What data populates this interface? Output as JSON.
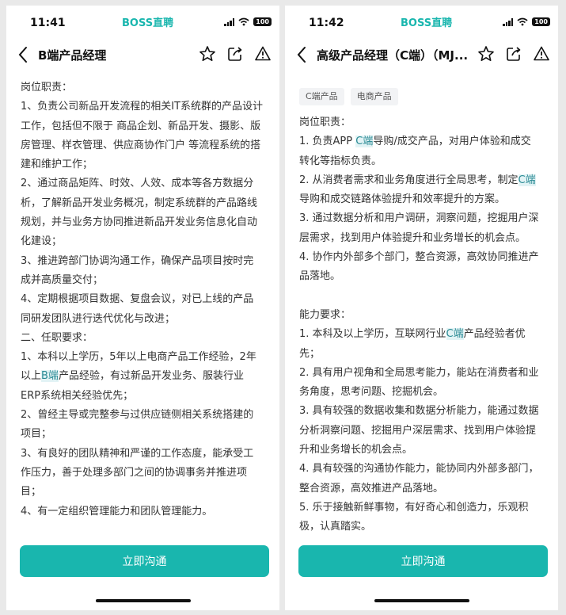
{
  "screens": [
    {
      "status": {
        "time": "11:41",
        "brand": "BOSS直聘",
        "battery": "100"
      },
      "nav": {
        "title": "B端产品经理"
      },
      "tags": [],
      "lines": [
        "岗位职责：",
        "1、负责公司新品开发流程的相关IT系统群的产品设计",
        "工作，包括但不限于 商品企划、新品开发、摄影、版",
        "房管理、样衣管理、供应商协作门户 等流程系统的搭",
        "建和维护工作；",
        "2、通过商品矩阵、时效、人效、成本等各方数据分",
        "析，了解新品开发业务概况，制定系统群的产品路线",
        "规划，并与业务方协同推进新品开发业务信息化自动",
        "化建设；",
        "3、推进跨部门协调沟通工作，确保产品项目按时完",
        "成并高质量交付；",
        "4、定期根据项目数据、复盘会议，对已上线的产品",
        "同研发团队进行迭代优化与改进；",
        "二、任职要求：",
        "1、本科以上学历，5年以上电商产品工作经验，2年",
        "以上B端产品经验，有过新品开发业务、服装行业",
        "ERP系统相关经验优先；",
        "2、曾经主导或完整参与过供应链侧相关系统搭建的",
        "项目；",
        "3、有良好的团队精神和严谨的工作态度，能承受工",
        "作压力，善于处理多部门之间的协调事务并推进项",
        "目；",
        "4、有一定组织管理能力和团队管理能力。"
      ],
      "cta": "立即沟通"
    },
    {
      "status": {
        "time": "11:42",
        "brand": "BOSS直聘",
        "battery": "100"
      },
      "nav": {
        "title": "高级产品经理（C端）（MJ..."
      },
      "tags": [
        "C端产品",
        "电商产品"
      ],
      "lines": [
        "岗位职责：",
        "1. 负责APP C端导购/成交产品，对用户体验和成交",
        "转化等指标负责。",
        "2. 从消费者需求和业务角度进行全局思考，制定C端",
        "导购和成交链路体验提升和效率提升的方案。",
        "3. 通过数据分析和用户调研，洞察问题，挖掘用户深",
        "层需求，找到用户体验提升和业务增长的机会点。",
        "4. 协作内外部多个部门，整合资源，高效协同推进产",
        "品落地。",
        "",
        "能力要求：",
        "1. 本科及以上学历，互联网行业C端产品经验者优",
        "先；",
        "2. 具有用户视角和全局思考能力，能站在消费者和业",
        "务角度，思考问题、挖掘机会。",
        "3. 具有较强的数据收集和数据分析能力，能通过数据",
        "分析洞察问题、挖掘用户深层需求、找到用户体验提",
        "升和业务增长的机会点。",
        "4. 具有较强的沟通协作能力，能协同内外部多部门，",
        "整合资源，高效推进产品落地。",
        "5. 乐于接触新鲜事物，有好奇心和创造力，乐观积",
        "极，认真踏实。"
      ],
      "cta": "立即沟通"
    }
  ],
  "highlight_color": "#e2f3f5",
  "accent_color": "#19b6ae"
}
